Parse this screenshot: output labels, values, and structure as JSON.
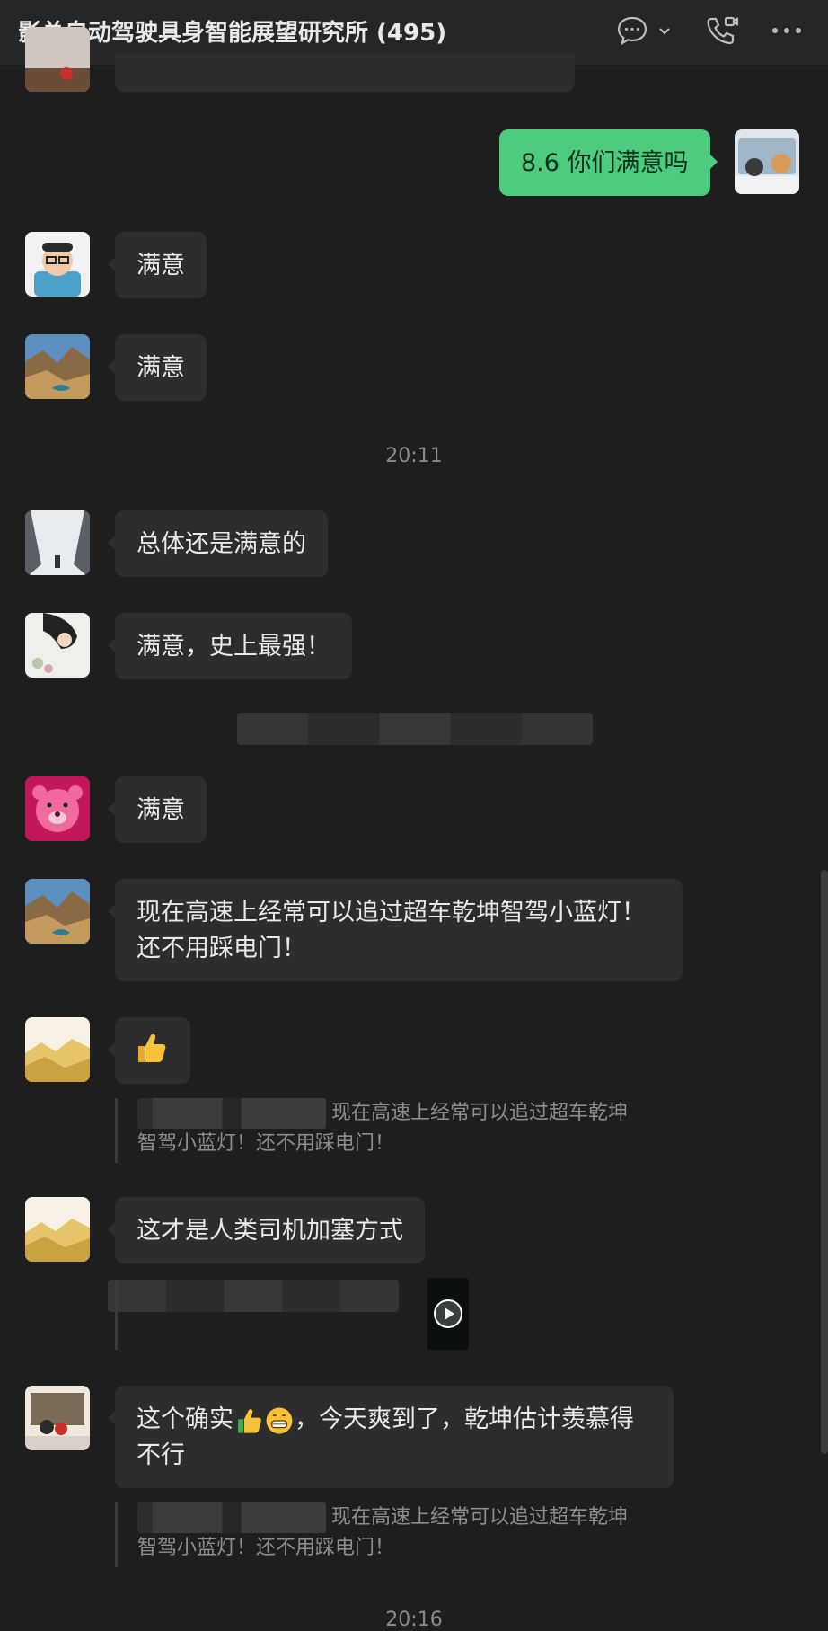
{
  "header": {
    "title": "影总自动驾驶具身智能展望研究所 (495)",
    "icons": [
      "chat-bubble-icon",
      "chevron-down-icon",
      "phone-video-icon",
      "more-icon"
    ]
  },
  "messages": [
    {
      "id": "m1",
      "sender": "self",
      "text": "8.6 你们满意吗"
    },
    {
      "id": "m2",
      "sender": "other",
      "text": "满意"
    },
    {
      "id": "m3",
      "sender": "other",
      "text": "满意"
    },
    {
      "id": "m4",
      "sender": "other",
      "text": "总体还是满意的"
    },
    {
      "id": "m5",
      "sender": "other",
      "text": "满意，史上最强！"
    },
    {
      "id": "m6",
      "sender": "other",
      "text": "满意"
    },
    {
      "id": "m7",
      "sender": "other",
      "line1": "现在高速上经常可以追过超车乾坤智驾小蓝灯！",
      "line2": "还不用踩电门！"
    },
    {
      "id": "m8",
      "sender": "other",
      "emoji": "thumbs-up-icon"
    },
    {
      "id": "m9",
      "sender": "other",
      "text": "这才是人类司机加塞方式"
    },
    {
      "id": "m10",
      "sender": "other",
      "line1_prefix": "这个确实",
      "line1_suffix": "，今天爽到了，乾坤估计羡慕得",
      "line2": "不行"
    }
  ],
  "timestamps": {
    "t1": "20:11",
    "t2": "20:16"
  },
  "quotes": {
    "q1": {
      "line1": "现在高速上经常可以追过超车乾坤",
      "line2": "智驾小蓝灯！还不用踩电门！"
    },
    "q2": {
      "line1": "现在高速上经常可以追过超车乾坤",
      "line2": "智驾小蓝灯！还不用踩电门！"
    }
  },
  "colors": {
    "background": "#1e1e1e",
    "bubble_other": "#2d2d2d",
    "bubble_self": "#4dcc7f",
    "timestamp": "#8a8a8a"
  }
}
